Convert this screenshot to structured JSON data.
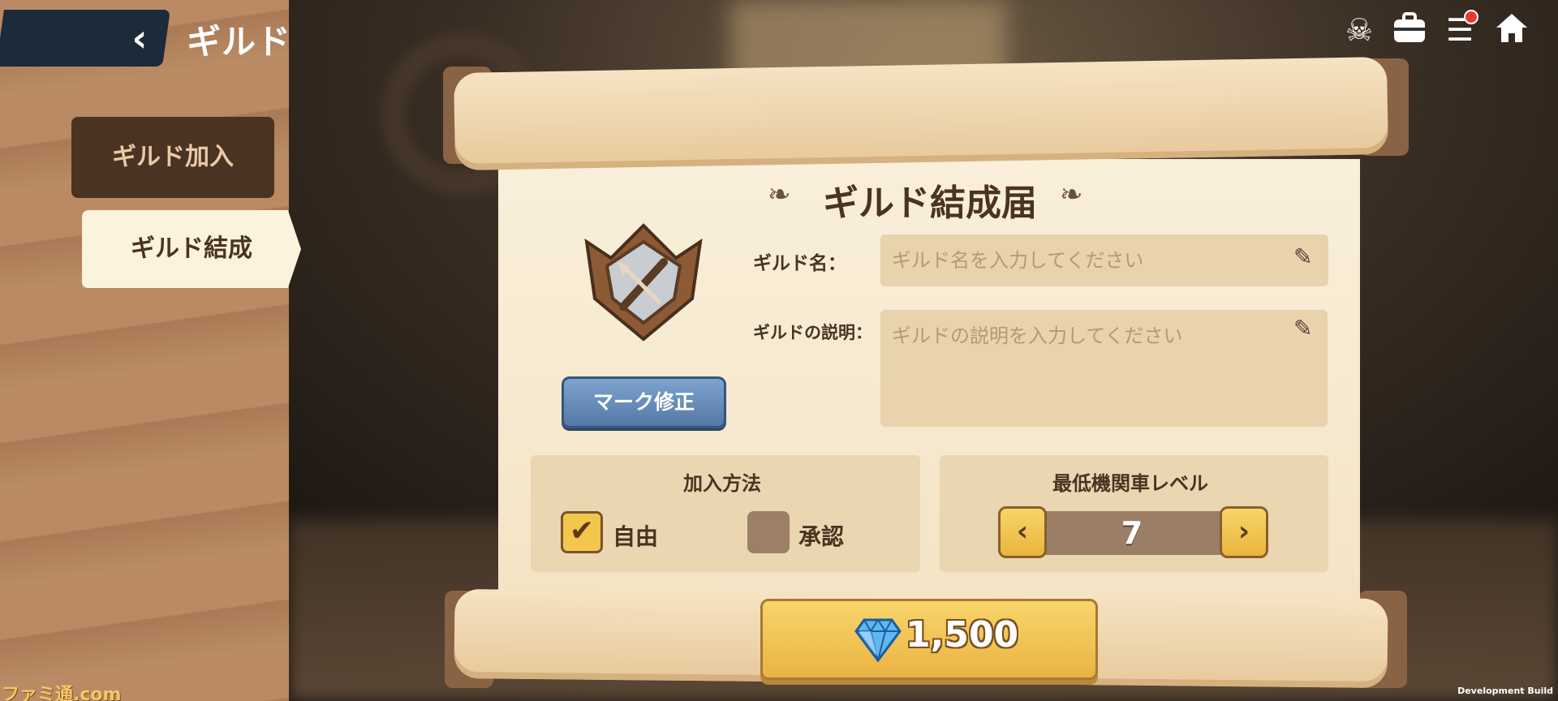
{
  "header": {
    "title": "ギルド",
    "back_icon": "back-arrow-icon"
  },
  "sidebar": {
    "tabs": [
      {
        "label": "ギルド加入",
        "active": false
      },
      {
        "label": "ギルド結成",
        "active": true
      }
    ]
  },
  "top_icons": [
    {
      "name": "skull-profile-icon",
      "glyph": "☠"
    },
    {
      "name": "briefcase-icon",
      "glyph": "💼"
    },
    {
      "name": "menu-icon",
      "glyph": "☰",
      "has_notification": true
    },
    {
      "name": "home-icon",
      "glyph": "⌂"
    }
  ],
  "form": {
    "title": "ギルド結成届",
    "mark_button": "マーク修正",
    "name_label": "ギルド名：",
    "name_placeholder": "ギルド名を入力してください",
    "desc_label": "ギルドの説明：",
    "desc_placeholder": "ギルドの説明を入力してください",
    "join_method": {
      "title": "加入方法",
      "options": [
        {
          "label": "自由",
          "checked": true
        },
        {
          "label": "承認",
          "checked": false
        }
      ]
    },
    "min_level": {
      "title": "最低機関車レベル",
      "value": "7"
    },
    "cost": {
      "value": "1,500",
      "icon": "diamond-gem-icon"
    }
  },
  "watermark": "ファミ通.com",
  "dev_build": "Development Build",
  "colors": {
    "accent_yellow": "#f3c64e",
    "button_blue": "#6a8fbd",
    "text_brown": "#4a3323",
    "paper": "#f9efdb"
  }
}
